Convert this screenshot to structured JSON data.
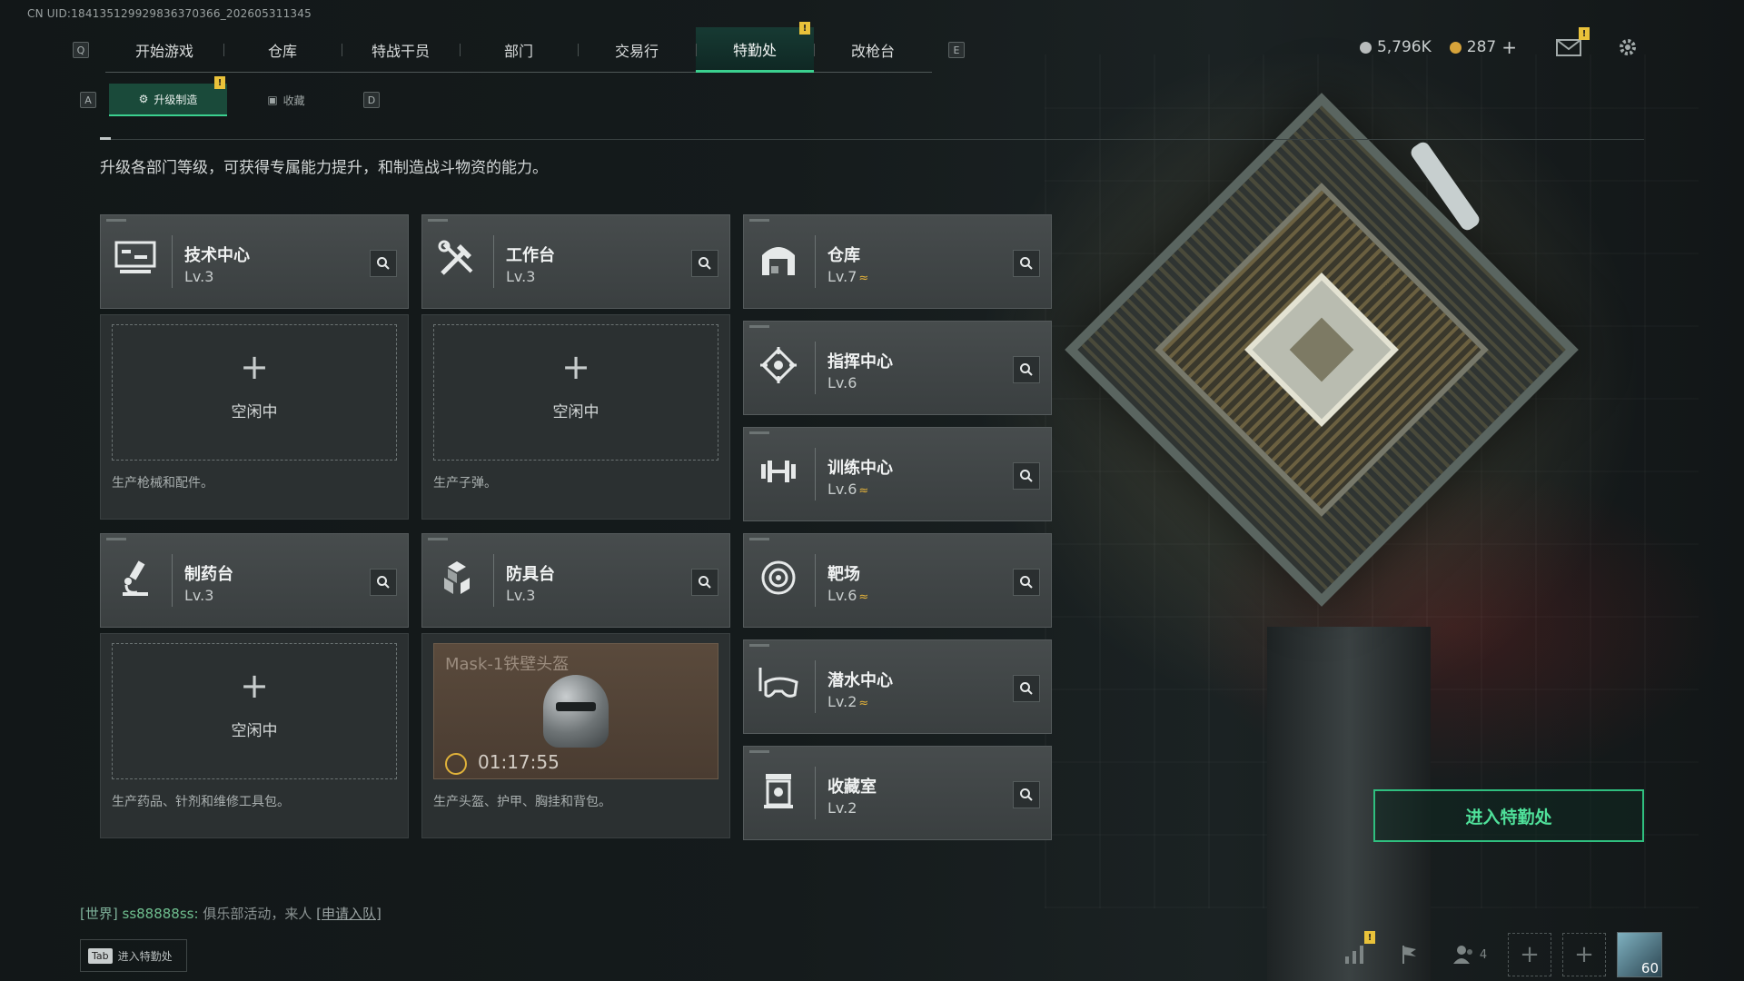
{
  "uid": "CN UID:18413512992983637036‌6_202605311345",
  "nav": {
    "key_left": "Q",
    "key_right": "E",
    "tabs": [
      "开始游戏",
      "仓库",
      "特战干员",
      "部门",
      "交易行",
      "特勤处",
      "改枪台"
    ],
    "active_tab": "特勤处",
    "alert_badge": "!"
  },
  "subnav": {
    "key_left": "A",
    "key_right": "D",
    "tabs": [
      "升级制造",
      "收藏"
    ],
    "active": "升级制造"
  },
  "currency": {
    "silver": "5,796K",
    "gold": "287",
    "add": "+",
    "silver_color": "#b8bcbc",
    "gold_color": "#d7a33a"
  },
  "description": "升级各部门等级，可获得专属能力提升，和制造战斗物资的能力。",
  "departments_left": [
    {
      "name": "技术中心",
      "level": "Lv.3",
      "icon": "computer-icon",
      "slot": {
        "plus": "+",
        "status": "空闲中",
        "desc": "生产枪械和配件。"
      }
    },
    {
      "name": "工作台",
      "level": "Lv.3",
      "icon": "tools-icon",
      "slot": {
        "plus": "+",
        "status": "空闲中",
        "desc": "生产子弹。"
      }
    },
    {
      "name": "制药台",
      "level": "Lv.3",
      "icon": "microscope-icon",
      "slot": {
        "plus": "+",
        "status": "空闲中",
        "desc": "生产药品、针剂和维修工具包。"
      }
    },
    {
      "name": "防具台",
      "level": "Lv.3",
      "icon": "armor-icon",
      "production": {
        "item": "Mask-1铁壁头盔",
        "timer": "01:17:55"
      },
      "slot": {
        "desc": "生产头盔、护甲、胸挂和背包。"
      }
    }
  ],
  "departments_right": [
    {
      "name": "仓库",
      "level": "Lv.7",
      "upgradable": true,
      "icon": "warehouse-icon"
    },
    {
      "name": "指挥中心",
      "level": "Lv.6",
      "upgradable": false,
      "icon": "command-icon"
    },
    {
      "name": "训练中心",
      "level": "Lv.6",
      "upgradable": true,
      "icon": "dumbbell-icon"
    },
    {
      "name": "靶场",
      "level": "Lv.6",
      "upgradable": true,
      "icon": "target-icon"
    },
    {
      "name": "潜水中心",
      "level": "Lv.2",
      "upgradable": true,
      "icon": "diving-mask-icon"
    },
    {
      "name": "收藏室",
      "level": "Lv.2",
      "upgradable": false,
      "icon": "collection-icon"
    }
  ],
  "upgrade_glyph": "≈",
  "enter_button": "进入特勤处",
  "chat": {
    "channel": "[世界]",
    "user": "ss88888ss:",
    "message": "俱乐部活动，来人",
    "link": "[申请入队]"
  },
  "tab_hint": {
    "key": "Tab",
    "label": "进入特勤处"
  },
  "bottom": {
    "friends_count": "4",
    "level": "60"
  },
  "accent_color": "#3bd08f"
}
